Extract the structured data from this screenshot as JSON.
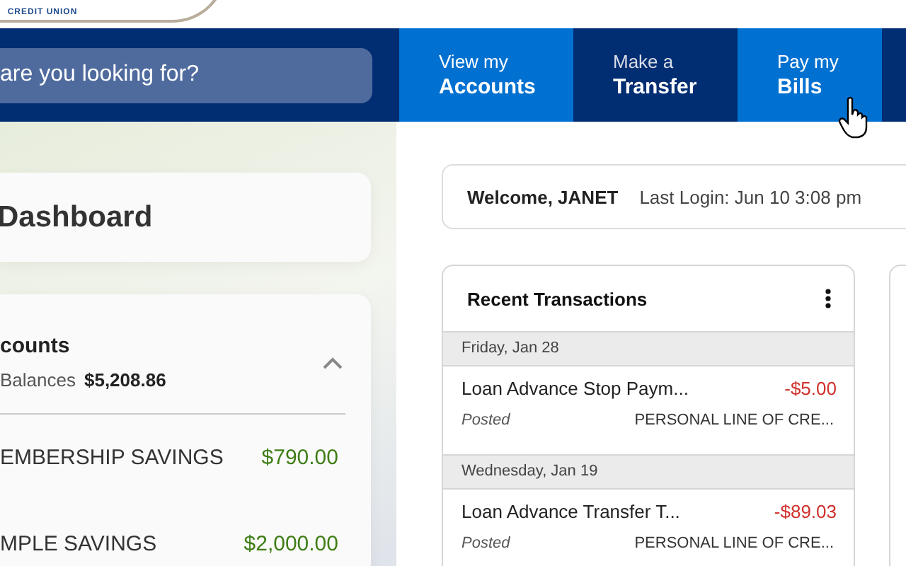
{
  "logo": {
    "text": "CREDIT UNION"
  },
  "search": {
    "placeholder": "are you looking for?"
  },
  "nav": [
    {
      "line1": "View my",
      "line2": "Accounts",
      "highlighted": true
    },
    {
      "line1": "Make a",
      "line2": "Transfer",
      "highlighted": false
    },
    {
      "line1": "Pay my",
      "line2": "Bills",
      "highlighted": true
    }
  ],
  "dashboard": {
    "title": "Dashboard"
  },
  "accounts": {
    "title": "counts",
    "balance_label": "Balances",
    "balance": "$5,208.86",
    "expanded": true,
    "items": [
      {
        "name": "EMBERSHIP SAVINGS",
        "amount": "$790.00"
      },
      {
        "name": "MPLE SAVINGS",
        "amount": "$2,000.00"
      }
    ]
  },
  "welcome": {
    "greeting": "Welcome, JANET",
    "last_login": "Last Login: Jun 10 3:08 pm"
  },
  "transactions": {
    "title": "Recent Transactions",
    "groups": [
      {
        "date": "Friday, Jan 28",
        "items": [
          {
            "description": "Loan Advance Stop Paym...",
            "amount": "-$5.00",
            "status": "Posted",
            "account": "PERSONAL LINE OF CRE..."
          }
        ]
      },
      {
        "date": "Wednesday, Jan 19",
        "items": [
          {
            "description": "Loan Advance Transfer T...",
            "amount": "-$89.03",
            "status": "Posted",
            "account": "PERSONAL LINE OF CRE..."
          }
        ]
      }
    ]
  }
}
